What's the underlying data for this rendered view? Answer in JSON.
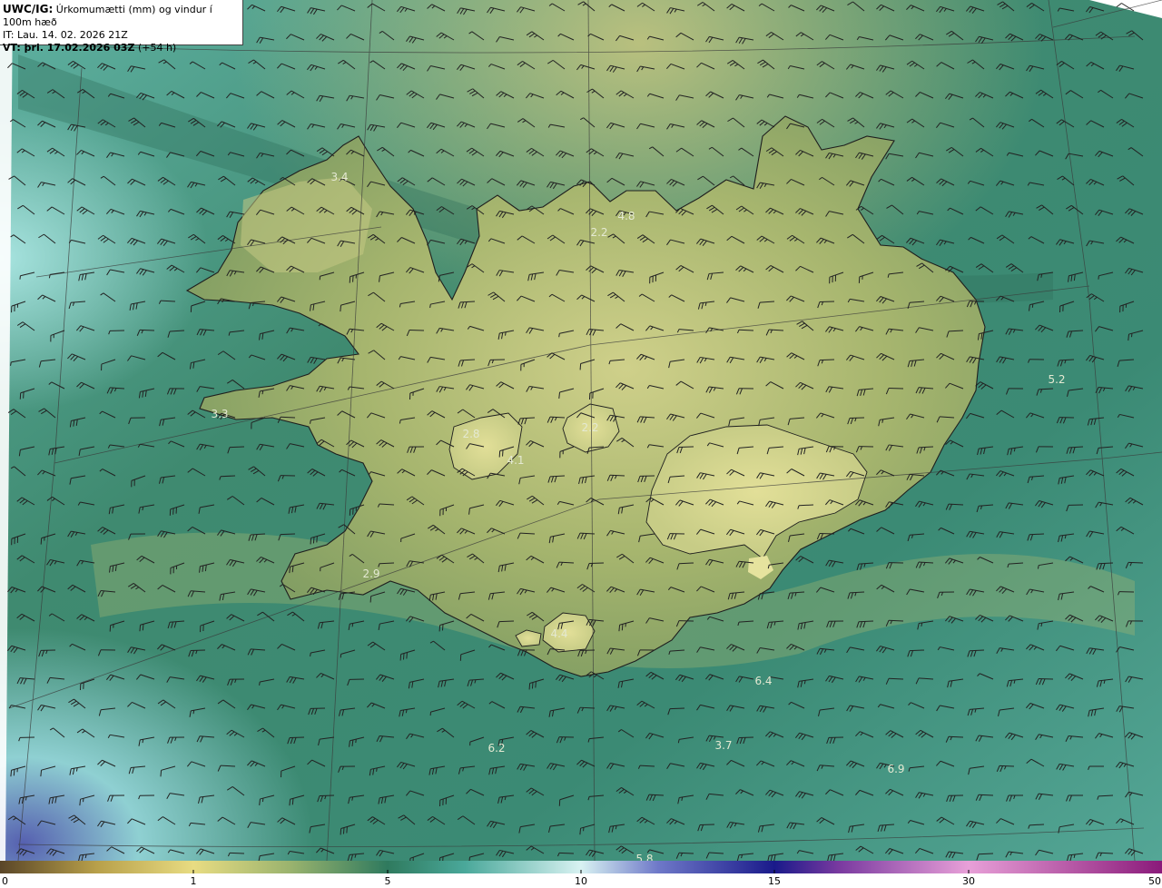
{
  "header": {
    "model": "UWC/IG:",
    "product": "Úrkomumætti (mm) og vindur í 100m hæð",
    "it_label": "IT:",
    "it_value": "Lau. 14. 02. 2026 21Z",
    "vt_label": "VT: þri. 17.02.2026 03Z",
    "vt_offset": "(+54 h)"
  },
  "colorbar": {
    "ticks": [
      "0",
      "1",
      "5",
      "10",
      "15",
      "30",
      "50"
    ],
    "stops": [
      {
        "value": 0,
        "color": "#5a4628"
      },
      {
        "value": 0.5,
        "color": "#b8a04a"
      },
      {
        "value": 1,
        "color": "#e8dc82"
      },
      {
        "value": 3,
        "color": "#9ab36e"
      },
      {
        "value": 5,
        "color": "#2f7a5e"
      },
      {
        "value": 7,
        "color": "#4aa89a"
      },
      {
        "value": 10,
        "color": "#d8f2f2"
      },
      {
        "value": 12,
        "color": "#6e78c8"
      },
      {
        "value": 15,
        "color": "#1a1a8a"
      },
      {
        "value": 20,
        "color": "#7a3aa0"
      },
      {
        "value": 30,
        "color": "#e8a0d8"
      },
      {
        "value": 50,
        "color": "#8a1a7a"
      }
    ]
  },
  "map_labels": [
    {
      "id": "label-westfjords-north",
      "text": "3.4"
    },
    {
      "id": "label-trollaskagi",
      "text": "2.2"
    },
    {
      "id": "label-eyjafjordur",
      "text": "4.8"
    },
    {
      "id": "label-east-sea",
      "text": "5.2"
    },
    {
      "id": "label-snaefellsnes",
      "text": "3.3"
    },
    {
      "id": "label-langjokull",
      "text": "2.8"
    },
    {
      "id": "label-langjokull-south",
      "text": "4.1"
    },
    {
      "id": "label-hofsjokull",
      "text": "2.2"
    },
    {
      "id": "label-reykjanes",
      "text": "2.9"
    },
    {
      "id": "label-myrdalsjokull",
      "text": "4.4"
    },
    {
      "id": "label-south-sea-east",
      "text": "6.4"
    },
    {
      "id": "label-south-sea-west",
      "text": "6.2"
    },
    {
      "id": "label-south-sea-mid",
      "text": "3.7"
    },
    {
      "id": "label-southeast-sea",
      "text": "6.9"
    },
    {
      "id": "label-bottom-edge",
      "text": "5.8"
    }
  ],
  "colors": {
    "sea_main": "#3f8a70",
    "land": "#a9b870",
    "glacier": "#d6d88e",
    "coastline": "#1e1e1e",
    "gridline": "#3a3a3a",
    "barb": "#222222"
  },
  "icons": [
    "wind-barb-icon"
  ]
}
